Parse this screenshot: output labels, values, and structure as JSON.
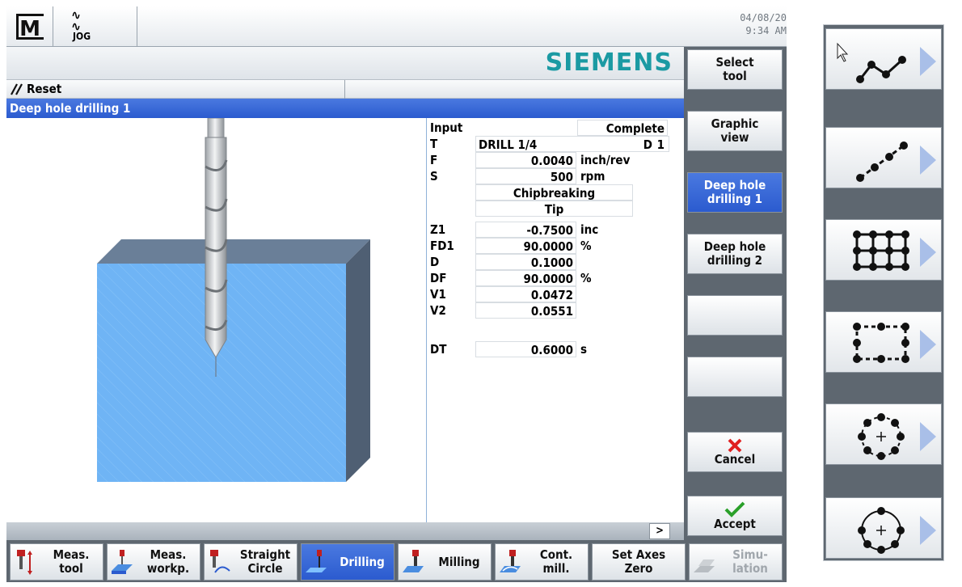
{
  "header": {
    "mode_icon_label": "JOG",
    "date": "04/08/20",
    "time": "9:34 AM",
    "brand": "SIEMENS"
  },
  "status": {
    "reset_label": "Reset"
  },
  "title": "Deep hole drilling 1",
  "params": {
    "input_label": "Input",
    "input_value": "Complete",
    "t_label": "T",
    "t_value": "DRILL 1/4",
    "d_label": "D",
    "d_value": "1",
    "f_label": "F",
    "f_value": "0.0040",
    "f_unit": "inch/rev",
    "s_label": "S",
    "s_value": "500",
    "s_unit": "rpm",
    "mode1": "Chipbreaking",
    "mode2": "Tip",
    "z1_label": "Z1",
    "z1_value": "-0.7500",
    "z1_unit": "inc",
    "fd1_label": "FD1",
    "fd1_value": "90.0000",
    "fd1_unit": "%",
    "dd_label": "D",
    "dd_value": "0.1000",
    "df_label": "DF",
    "df_value": "90.0000",
    "df_unit": "%",
    "v1_label": "V1",
    "v1_value": "0.0472",
    "v2_label": "V2",
    "v2_value": "0.0551",
    "dt_label": "DT",
    "dt_value": "0.6000",
    "dt_unit": "s"
  },
  "scroll_button": ">",
  "vertical_softkeys": [
    {
      "line1": "Select",
      "line2": "tool"
    },
    {
      "line1": "Graphic",
      "line2": "view"
    },
    {
      "line1": "Deep hole",
      "line2": "drilling 1"
    },
    {
      "line1": "Deep hole",
      "line2": "drilling 2"
    },
    {
      "line1": "",
      "line2": ""
    },
    {
      "line1": "",
      "line2": ""
    },
    {
      "line1": "Cancel",
      "line2": ""
    },
    {
      "line1": "Accept",
      "line2": ""
    }
  ],
  "horizontal_softkeys": [
    {
      "line1": "Meas.",
      "line2": "tool"
    },
    {
      "line1": "Meas.",
      "line2": "workp."
    },
    {
      "line1": "Straight",
      "line2": "Circle"
    },
    {
      "line1": "Drilling",
      "line2": ""
    },
    {
      "line1": "Milling",
      "line2": ""
    },
    {
      "line1": "Cont.",
      "line2": "mill."
    },
    {
      "line1": "Set Axes",
      "line2": "Zero"
    },
    {
      "line1": "Simu-",
      "line2": "lation"
    }
  ],
  "right_panel_icons": [
    "arbitrary-positions-icon",
    "line-positions-icon",
    "grid-positions-icon",
    "frame-positions-icon",
    "full-circle-positions-icon",
    "pitch-circle-positions-icon"
  ],
  "colors": {
    "accent_blue": "#2b5bcf",
    "brand_teal": "#1b9aa3",
    "softkey_bar": "#5e6770",
    "cancel_red": "#e02020",
    "accept_green": "#2aa02a",
    "workpiece_blue": "#6fb4f5"
  }
}
